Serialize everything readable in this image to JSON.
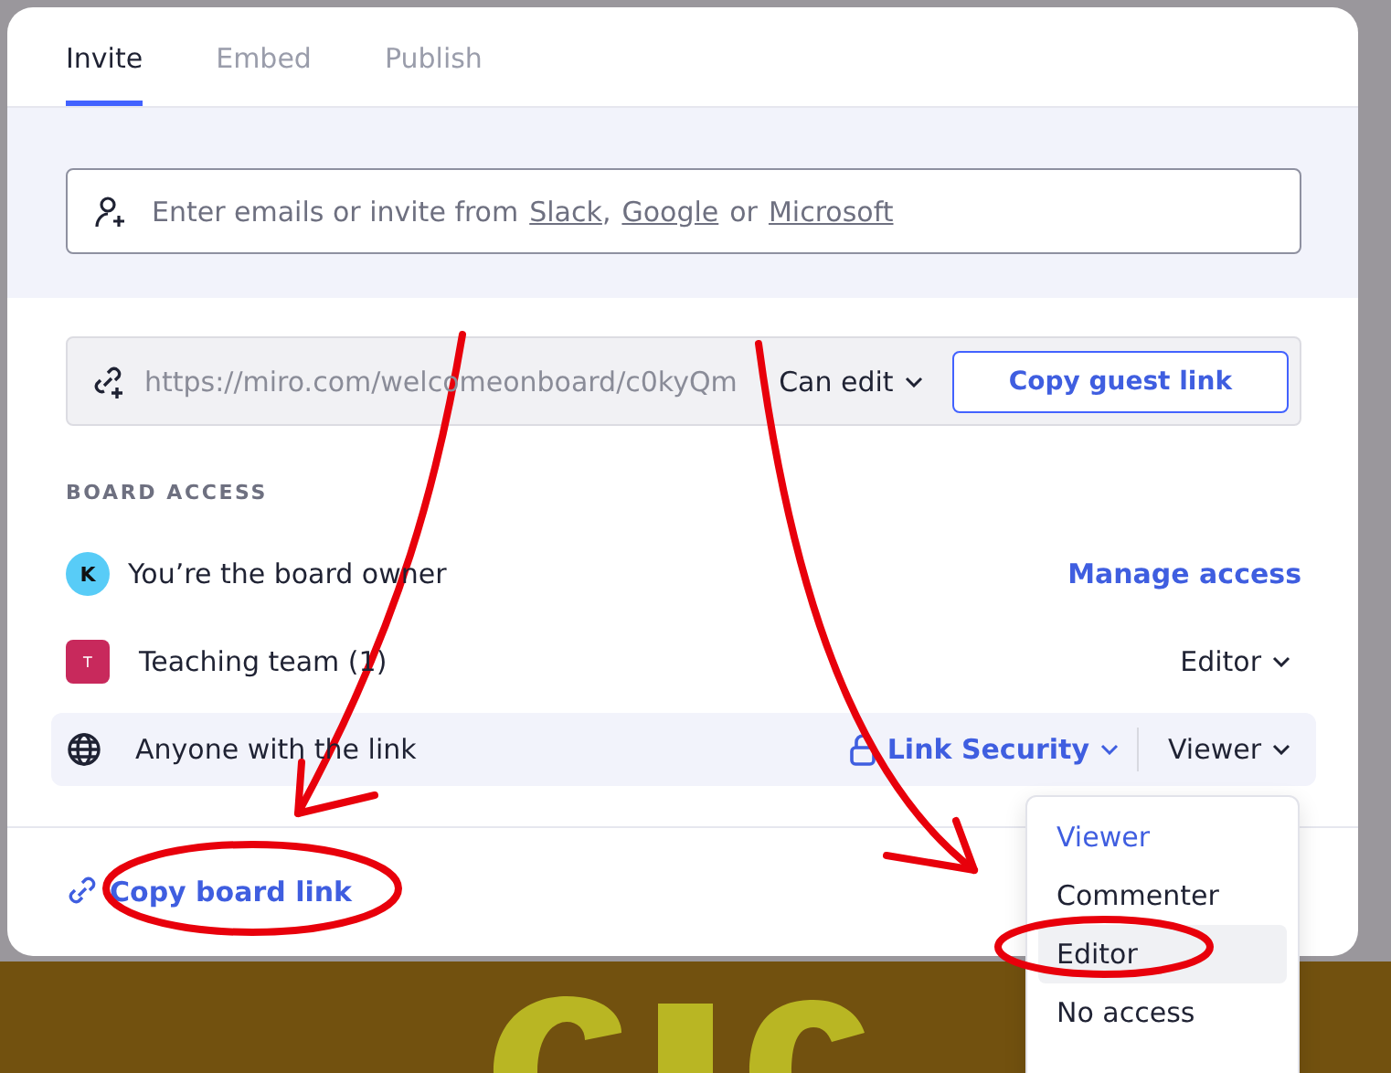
{
  "tabs": [
    {
      "label": "Invite",
      "selected": true
    },
    {
      "label": "Embed",
      "selected": false
    },
    {
      "label": "Publish",
      "selected": false
    }
  ],
  "invite_field": {
    "placeholder_parts": [
      {
        "kind": "plain",
        "text": "Enter emails or invite from"
      },
      {
        "kind": "link",
        "text": "Slack"
      },
      {
        "kind": "plain",
        "text": ","
      },
      {
        "kind": "link",
        "text": "Google"
      },
      {
        "kind": "plain",
        "text": "or"
      },
      {
        "kind": "link",
        "text": "Microsoft"
      }
    ]
  },
  "link_row": {
    "url": "https://miro.com/welcomeonboard/c0kyQm",
    "permission": "Can edit",
    "button": "Copy guest link"
  },
  "board_access": {
    "heading": "BOARD ACCESS",
    "rows": [
      {
        "kind": "owner",
        "avatar": "K",
        "label": "You’re the board owner",
        "action": "Manage access"
      },
      {
        "kind": "team",
        "avatar": "T",
        "label": "Teaching team (1)",
        "role": "Editor"
      },
      {
        "kind": "link",
        "label": "Anyone with the link",
        "security": "Link Security",
        "role": "Viewer"
      }
    ]
  },
  "footer": {
    "copy_link": "Copy board link"
  },
  "role_menu": [
    {
      "label": "Viewer",
      "selected": true,
      "hovered": false
    },
    {
      "label": "Commenter",
      "selected": false,
      "hovered": false
    },
    {
      "label": "Editor",
      "selected": false,
      "hovered": true
    },
    {
      "label": "No access",
      "selected": false,
      "hovered": false
    }
  ]
}
